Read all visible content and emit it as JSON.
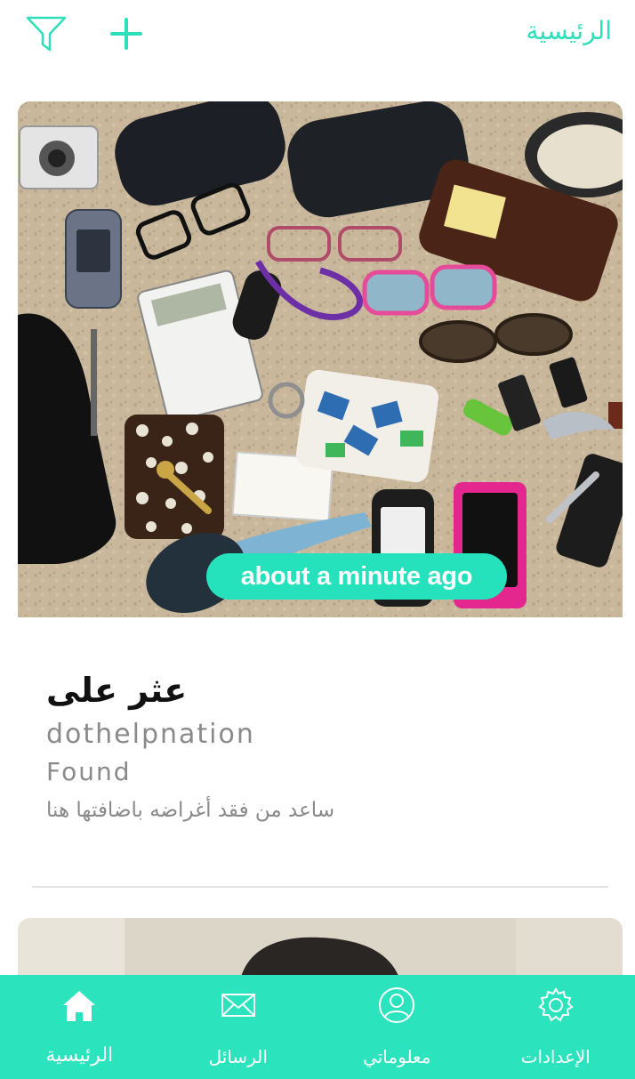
{
  "header": {
    "title": "الرئيسية",
    "filter_icon": "filter-icon",
    "add_icon": "plus-icon"
  },
  "feed": {
    "items": [
      {
        "time_ago": "about a minute ago",
        "title": "عثر على",
        "user": "dothelpnation",
        "status": "Found",
        "description": "ساعد من فقد أغراضه باضافتها هنا"
      }
    ]
  },
  "bottom_nav": {
    "items": [
      {
        "label": "الرئيسية",
        "icon": "home-icon",
        "active": true
      },
      {
        "label": "الرسائل",
        "icon": "mail-icon",
        "active": false
      },
      {
        "label": "معلوماتي",
        "icon": "user-icon",
        "active": false
      },
      {
        "label": "الإعدادات",
        "icon": "gear-icon",
        "active": false
      }
    ]
  },
  "colors": {
    "accent": "#2be3bd",
    "header_text": "#2ee0b9",
    "muted_text": "#8a8a8a"
  }
}
